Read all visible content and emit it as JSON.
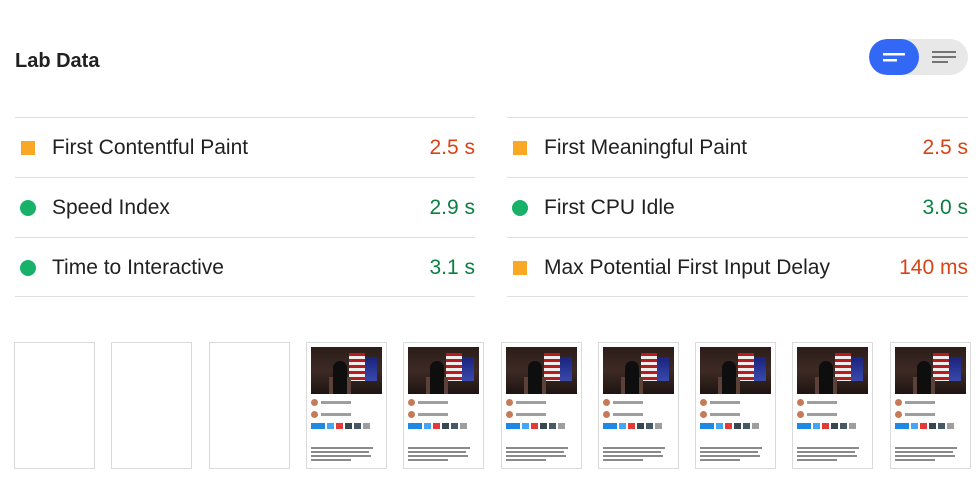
{
  "header": {
    "title": "Lab Data"
  },
  "view_toggle": {
    "options": [
      {
        "icon": "summary-view-icon",
        "active": true
      },
      {
        "icon": "detailed-view-icon",
        "active": false
      }
    ],
    "active_color": "#3367f5"
  },
  "metrics": {
    "left": [
      {
        "label": "First Contentful Paint",
        "value": "2.5 s",
        "rating": "average",
        "marker": "square"
      },
      {
        "label": "Speed Index",
        "value": "2.9 s",
        "rating": "fast",
        "marker": "circle"
      },
      {
        "label": "Time to Interactive",
        "value": "3.1 s",
        "rating": "fast",
        "marker": "circle"
      }
    ],
    "right": [
      {
        "label": "First Meaningful Paint",
        "value": "2.5 s",
        "rating": "average",
        "marker": "square"
      },
      {
        "label": "First CPU Idle",
        "value": "3.0 s",
        "rating": "fast",
        "marker": "circle"
      },
      {
        "label": "Max Potential First Input Delay",
        "value": "140 ms",
        "rating": "average",
        "marker": "square"
      }
    ]
  },
  "colors": {
    "average": "#d84315",
    "average_marker": "#f9a825",
    "fast": "#0b8043",
    "fast_marker": "#17b169"
  },
  "filmstrip": {
    "frames": [
      {
        "loaded": false
      },
      {
        "loaded": false
      },
      {
        "loaded": false
      },
      {
        "loaded": true
      },
      {
        "loaded": true
      },
      {
        "loaded": true
      },
      {
        "loaded": true
      },
      {
        "loaded": true
      },
      {
        "loaded": true
      },
      {
        "loaded": true
      }
    ]
  }
}
